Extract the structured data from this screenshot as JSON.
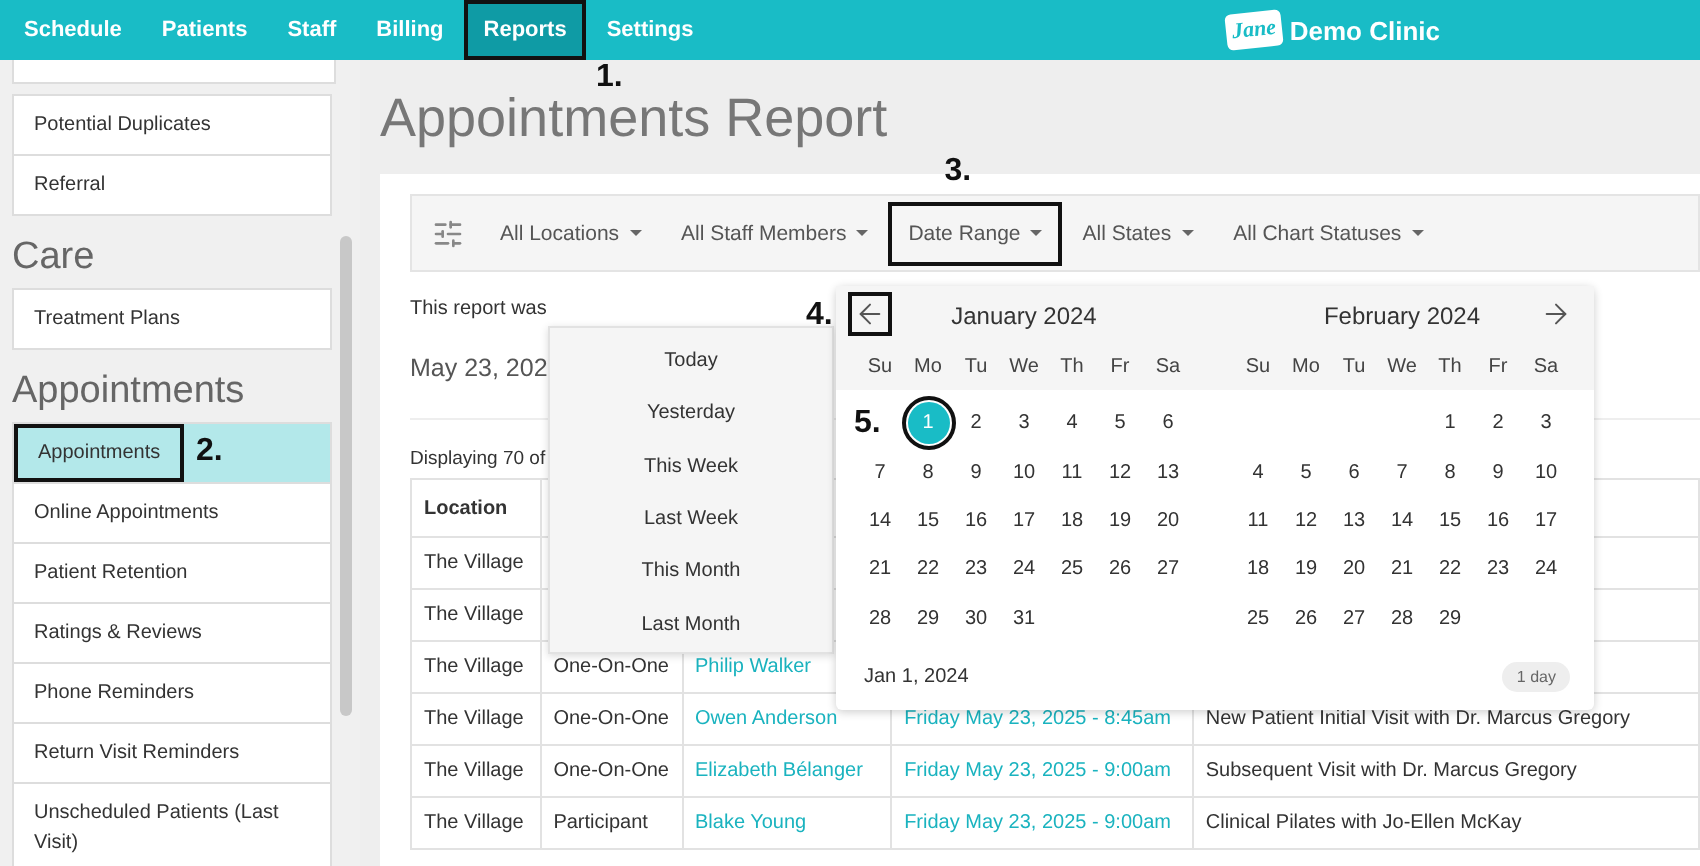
{
  "nav": {
    "items": [
      {
        "label": "Schedule",
        "selected": false
      },
      {
        "label": "Patients",
        "selected": false
      },
      {
        "label": "Staff",
        "selected": false
      },
      {
        "label": "Billing",
        "selected": false
      },
      {
        "label": "Reports",
        "selected": true,
        "callout": "1."
      },
      {
        "label": "Settings",
        "selected": false
      }
    ],
    "logo_text": "Jane",
    "clinic": "Demo Clinic"
  },
  "sidebar": {
    "sections": [
      {
        "items": [
          {
            "label": "Potential Duplicates",
            "selected": false
          },
          {
            "label": "Referral",
            "selected": false
          }
        ]
      },
      {
        "heading": "Care",
        "items": [
          {
            "label": "Treatment Plans",
            "selected": false
          }
        ]
      },
      {
        "heading": "Appointments",
        "items": [
          {
            "label": "Appointments",
            "selected": true,
            "callout": "2."
          },
          {
            "label": "Online Appointments",
            "selected": false
          },
          {
            "label": "Patient Retention",
            "selected": false
          },
          {
            "label": "Ratings & Reviews",
            "selected": false
          },
          {
            "label": "Phone Reminders",
            "selected": false
          },
          {
            "label": "Return Visit Reminders",
            "selected": false
          },
          {
            "label": "Unscheduled Patients (Last Visit)",
            "selected": false
          }
        ]
      }
    ]
  },
  "page": {
    "title": "Appointments Report",
    "filters": [
      {
        "label": "All Locations"
      },
      {
        "label": "All Staff Members"
      },
      {
        "label": "Date Range",
        "callout": "3."
      },
      {
        "label": "All States"
      },
      {
        "label": "All Chart Statuses"
      }
    ],
    "generated_note": "This report was",
    "date_heading": "May 23, 202",
    "displaying": "Displaying 70 of",
    "table": {
      "columns": [
        "Location"
      ],
      "rows": [
        {
          "cells": [
            "The Village"
          ]
        },
        {
          "cells": [
            "The Village"
          ]
        },
        {
          "cells": [
            "The Village",
            "One-On-One",
            "Philip Walker"
          ]
        },
        {
          "cells": [
            "The Village",
            "One-On-One",
            "Owen Anderson",
            "Friday May 23, 2025 - 8:45am",
            "New Patient Initial Visit with Dr. Marcus Gregory"
          ]
        },
        {
          "cells": [
            "The Village",
            "One-On-One",
            "Elizabeth Bélanger",
            "Friday May 23, 2025 - 9:00am",
            "Subsequent Visit with Dr. Marcus Gregory"
          ]
        },
        {
          "cells": [
            "The Village",
            "Participant",
            "Blake Young",
            "Friday May 23, 2025 - 9:00am",
            "Clinical Pilates with Jo-Ellen McKay"
          ]
        }
      ]
    }
  },
  "date_presets": [
    {
      "label": "Today"
    },
    {
      "label": "Yesterday"
    },
    {
      "label": "This Week"
    },
    {
      "label": "Last Week"
    },
    {
      "label": "This Month"
    },
    {
      "label": "Last Month"
    }
  ],
  "calendar": {
    "prev_callout": "4.",
    "months": [
      {
        "title": "January 2024",
        "weekdays": [
          "Su",
          "Mo",
          "Tu",
          "We",
          "Th",
          "Fr",
          "Sa"
        ],
        "weeks": [
          [
            {
              "day": "1",
              "selected": true,
              "callout": "5."
            },
            {
              "day": "2",
              "selected": false
            },
            {
              "day": "3",
              "selected": false
            },
            {
              "day": "4",
              "selected": false
            },
            {
              "day": "5",
              "selected": false
            },
            {
              "day": "6",
              "selected": false
            }
          ],
          [
            {
              "day": "7",
              "selected": false
            },
            {
              "day": "8",
              "selected": false
            },
            {
              "day": "9",
              "selected": false
            },
            {
              "day": "10",
              "selected": false
            },
            {
              "day": "11",
              "selected": false
            },
            {
              "day": "12",
              "selected": false
            },
            {
              "day": "13",
              "selected": false
            }
          ],
          [
            {
              "day": "14",
              "selected": false
            },
            {
              "day": "15",
              "selected": false
            },
            {
              "day": "16",
              "selected": false
            },
            {
              "day": "17",
              "selected": false
            },
            {
              "day": "18",
              "selected": false
            },
            {
              "day": "19",
              "selected": false
            },
            {
              "day": "20",
              "selected": false
            }
          ],
          [
            {
              "day": "21",
              "selected": false
            },
            {
              "day": "22",
              "selected": false
            },
            {
              "day": "23",
              "selected": false
            },
            {
              "day": "24",
              "selected": false
            },
            {
              "day": "25",
              "selected": false
            },
            {
              "day": "26",
              "selected": false
            },
            {
              "day": "27",
              "selected": false
            }
          ],
          [
            {
              "day": "28",
              "selected": false
            },
            {
              "day": "29",
              "selected": false
            },
            {
              "day": "30",
              "selected": false
            },
            {
              "day": "31",
              "selected": false
            }
          ]
        ]
      },
      {
        "title": "February 2024",
        "weekdays": [
          "Su",
          "Mo",
          "Tu",
          "We",
          "Th",
          "Fr",
          "Sa"
        ],
        "weeks": [
          [
            {
              "day": "1",
              "selected": false
            },
            {
              "day": "2",
              "selected": false
            },
            {
              "day": "3",
              "selected": false
            }
          ],
          [
            {
              "day": "4",
              "selected": false
            },
            {
              "day": "5",
              "selected": false
            },
            {
              "day": "6",
              "selected": false
            },
            {
              "day": "7",
              "selected": false
            },
            {
              "day": "8",
              "selected": false
            },
            {
              "day": "9",
              "selected": false
            },
            {
              "day": "10",
              "selected": false
            }
          ],
          [
            {
              "day": "11",
              "selected": false
            },
            {
              "day": "12",
              "selected": false
            },
            {
              "day": "13",
              "selected": false
            },
            {
              "day": "14",
              "selected": false
            },
            {
              "day": "15",
              "selected": false
            },
            {
              "day": "16",
              "selected": false
            },
            {
              "day": "17",
              "selected": false
            }
          ],
          [
            {
              "day": "18",
              "selected": false
            },
            {
              "day": "19",
              "selected": false
            },
            {
              "day": "20",
              "selected": false
            },
            {
              "day": "21",
              "selected": false
            },
            {
              "day": "22",
              "selected": false
            },
            {
              "day": "23",
              "selected": false
            },
            {
              "day": "24",
              "selected": false
            }
          ],
          [
            {
              "day": "25",
              "selected": false
            },
            {
              "day": "26",
              "selected": false
            },
            {
              "day": "27",
              "selected": false
            },
            {
              "day": "28",
              "selected": false
            },
            {
              "day": "29",
              "selected": false
            }
          ]
        ]
      }
    ],
    "range_text": "Jan 1, 2024",
    "range_length": "1 day"
  }
}
